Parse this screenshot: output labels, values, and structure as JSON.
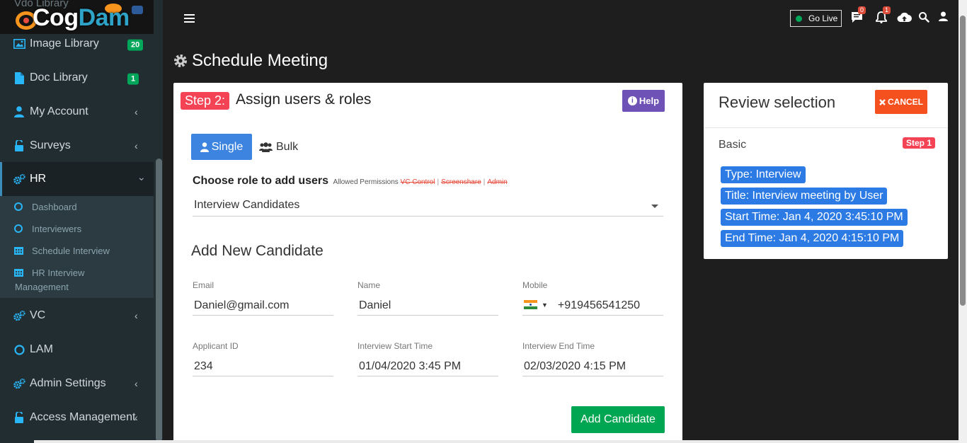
{
  "brand": {
    "logo_cog": "Cog",
    "logo_dam": "Dam",
    "ghost_text": "Vdo Library"
  },
  "sidebar": {
    "items": [
      {
        "label": "Image Library",
        "badge": "20"
      },
      {
        "label": "Doc Library",
        "badge": "1"
      },
      {
        "label": "My Account"
      },
      {
        "label": "Surveys"
      },
      {
        "label": "HR"
      },
      {
        "label": "VC"
      },
      {
        "label": "LAM"
      },
      {
        "label": "Admin Settings"
      },
      {
        "label": "Access Management"
      }
    ],
    "hr_sub": [
      {
        "label": "Dashboard"
      },
      {
        "label": "Interviewers"
      },
      {
        "label": "Schedule Interview"
      },
      {
        "label": "HR Interview",
        "label2": "Management"
      }
    ]
  },
  "header": {
    "go_live": "Go Live",
    "chat_count": "0",
    "notif_count": "1"
  },
  "page": {
    "title": "Schedule Meeting"
  },
  "form": {
    "step_label": "Step 2:",
    "title": "Assign users & roles",
    "help": "Help",
    "tab_single": "Single",
    "tab_bulk": "Bulk",
    "role_heading": "Choose role to add users",
    "allowed_permissions": "Allowed Permissions",
    "perm_vc": "VC Control",
    "perm_screenshare": "Screenshare",
    "perm_admin": "Admin",
    "perm_sep": "|",
    "role_value": "Interview Candidates",
    "section_title": "Add New Candidate",
    "email_label": "Email",
    "email_value": "Daniel@gmail.com",
    "name_label": "Name",
    "name_value": "Daniel",
    "mobile_label": "Mobile",
    "mobile_value": "+919456541250",
    "applicant_label": "Applicant ID",
    "applicant_value": "234",
    "start_label": "Interview Start Time",
    "start_value": "01/04/2020 3:45 PM",
    "end_label": "Interview End Time",
    "end_value": "02/03/2020 4:15 PM",
    "add_button": "Add Candidate"
  },
  "review": {
    "title": "Review selection",
    "cancel": "CANCEL",
    "basic": "Basic",
    "step_badge": "Step 1",
    "type": "Type: Interview",
    "meeting_title": "Title: Interview meeting by User",
    "start": "Start Time: Jan 4, 2020 3:45:10 PM",
    "end": "End Time: Jan 4, 2020 4:15:10 PM"
  },
  "colors": {
    "sidebar_bg": "#222d32",
    "accent_blue": "#3c84e0",
    "step_red": "#f44355",
    "help_purple": "#6f52b5",
    "cancel_orange": "#f4511e",
    "add_green": "#00a651"
  },
  "icons": [
    "image-icon",
    "file-icon",
    "user-icon",
    "lock-icon",
    "cogs-icon",
    "circle-icon",
    "calendar-icon",
    "menu-icon",
    "chat-icon",
    "bell-icon",
    "cloud-upload-icon",
    "search-icon",
    "gear-icon",
    "info-icon",
    "users-icon",
    "times-icon",
    "caret-down-icon",
    "flag-india-icon"
  ]
}
